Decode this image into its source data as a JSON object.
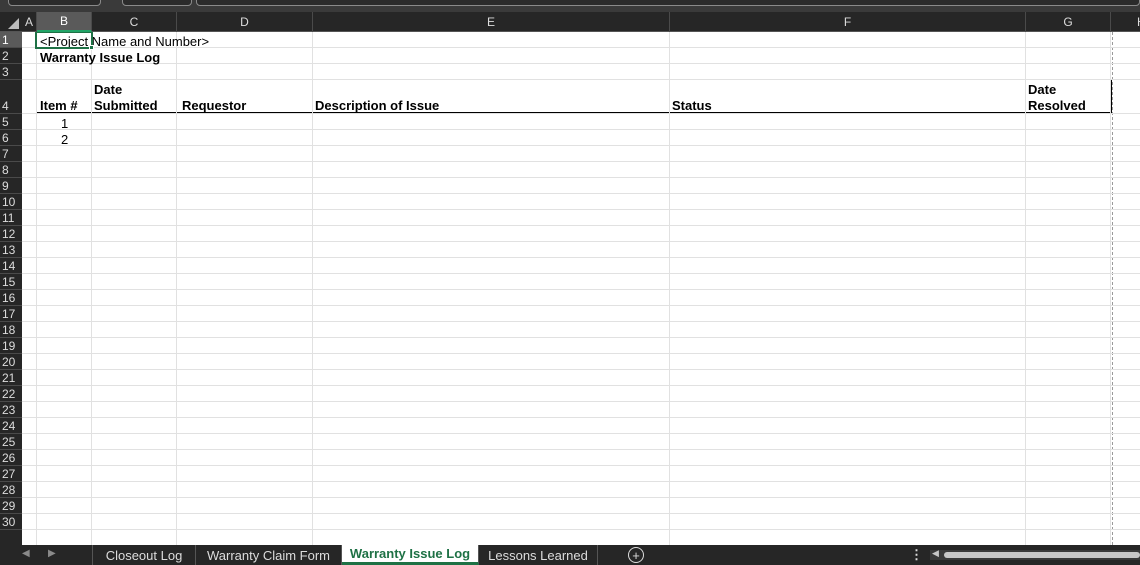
{
  "columns": [
    "A",
    "B",
    "C",
    "D",
    "E",
    "F",
    "G",
    "H"
  ],
  "rows": [
    "1",
    "2",
    "3",
    "4",
    "5",
    "6",
    "7",
    "8",
    "9",
    "10",
    "11",
    "12",
    "13",
    "14",
    "15",
    "16",
    "17",
    "18",
    "19",
    "20",
    "21",
    "22",
    "23",
    "24",
    "25",
    "26",
    "27",
    "28",
    "29",
    "30"
  ],
  "cells": {
    "b1": "<Project Name and Number>",
    "b2": "Warranty Issue Log",
    "b4": "Item #",
    "c4_line1": "Date",
    "c4_line2": "Submitted",
    "d4": "Requestor",
    "e4": "Description of Issue",
    "f4": "Status",
    "g4_line1": "Date",
    "g4_line2": "Resolved",
    "b5": "1",
    "b6": "2"
  },
  "selected_cell": "B1",
  "sheet_tabs": [
    {
      "label": "Closeout Log",
      "active": false
    },
    {
      "label": "Warranty Claim Form",
      "active": false
    },
    {
      "label": "Warranty Issue Log",
      "active": true
    },
    {
      "label": "Lessons Learned",
      "active": false
    }
  ],
  "icons": {
    "add_sheet": "plus-circle-icon",
    "prev": "chevron-left-icon",
    "next": "chevron-right-icon",
    "more": "vertical-dots-icon"
  },
  "colors": {
    "accent": "#1e7145",
    "header_bg": "#262626"
  }
}
